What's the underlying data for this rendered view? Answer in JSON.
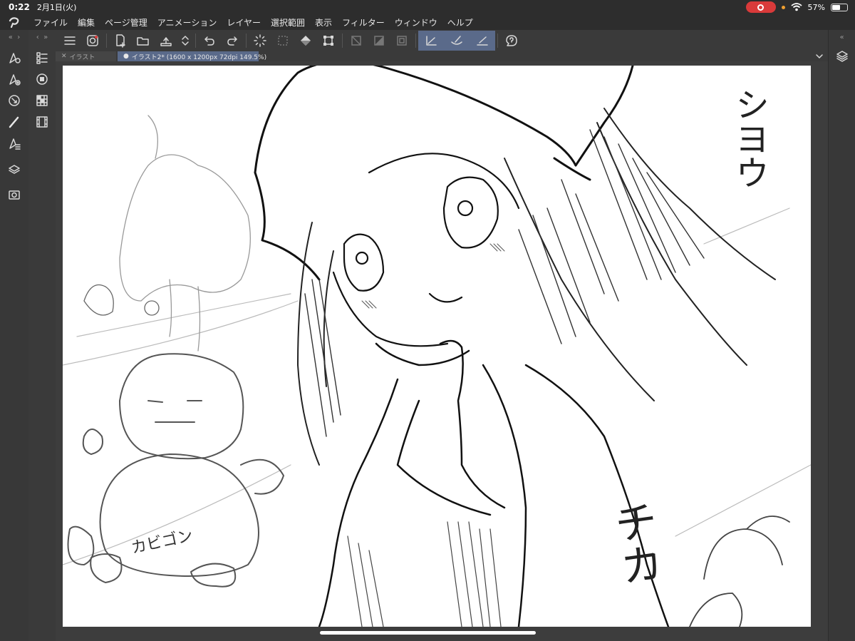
{
  "status": {
    "time": "0:22",
    "date": "2月1日(火)",
    "battery": "57%",
    "battery_level": 0.57
  },
  "menu": {
    "items": [
      "ファイル",
      "編集",
      "ページ管理",
      "アニメーション",
      "レイヤー",
      "選択範囲",
      "表示",
      "フィルター",
      "ウィンドウ",
      "ヘルプ"
    ]
  },
  "tabs": [
    {
      "label": "イラスト",
      "active": false
    },
    {
      "label": "イラスト2* (1600 x 1200px 72dpi 149.5%)",
      "active": true
    }
  ],
  "canvas": {
    "handwriting_top_right": "シヨウ",
    "handwriting_left": "カビゴン",
    "handwriting_bottom_right": "チカ"
  },
  "icons": {
    "left_rail": [
      "tool-property-icon",
      "brush-size-icon",
      "navigator-icon",
      "pen-tool-icon",
      "sub-tool-icon",
      "layer-property-icon",
      "material-icon"
    ],
    "second_rail": [
      "layer-list-icon",
      "color-circle-icon",
      "color-set-icon",
      "animation-icon"
    ],
    "toolbar": [
      "menu-icon",
      "companion-icon",
      "new-icon",
      "open-icon",
      "save-icon",
      "stepper-icon",
      "undo-icon",
      "redo-icon",
      "loading-icon",
      "select-clear-icon",
      "fill-icon",
      "transform-icon",
      "snap-ruler-icon",
      "snap-special-icon",
      "snap-grid-icon",
      "stabilize-1-icon",
      "stabilize-2-icon",
      "stabilize-3-icon",
      "help-icon"
    ]
  },
  "colors": {
    "accent": "#5a6a8a",
    "recording": "#d93a3a",
    "background": "#3d3d3d"
  }
}
